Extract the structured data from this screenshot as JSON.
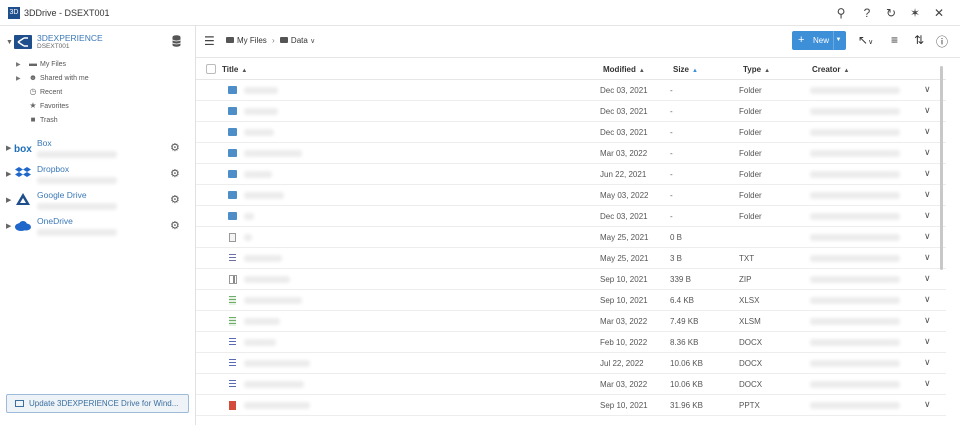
{
  "window": {
    "title": "3DDrive - DSEXT001",
    "logo_letter": "3D"
  },
  "sidebar": {
    "drives": [
      {
        "name": "3DEXPERIENCE",
        "subtitle": "DSEXT001",
        "logo": "3dexperience-logo"
      },
      {
        "name": "Box",
        "logo": "box-logo"
      },
      {
        "name": "Dropbox",
        "logo": "dropbox-logo"
      },
      {
        "name": "Google Drive",
        "logo": "google-drive-logo"
      },
      {
        "name": "OneDrive",
        "logo": "onedrive-logo"
      }
    ],
    "items": [
      {
        "label": "My Files",
        "icon": "folder-icon"
      },
      {
        "label": "Shared with me",
        "icon": "users-icon"
      },
      {
        "label": "Recent",
        "icon": "clock-icon"
      },
      {
        "label": "Favorites",
        "icon": "star-icon"
      },
      {
        "label": "Trash",
        "icon": "trash-icon"
      }
    ],
    "update_button": "Update 3DEXPERIENCE Drive for Wind..."
  },
  "toolbar": {
    "breadcrumb": [
      "My Files",
      "Data"
    ],
    "new_label": "New"
  },
  "table": {
    "columns": {
      "title": "Title",
      "modified": "Modified",
      "size": "Size",
      "type": "Type",
      "creator": "Creator"
    },
    "rows": [
      {
        "modified": "Dec 03, 2021",
        "size": "-",
        "type": "Folder",
        "icon": "folder"
      },
      {
        "modified": "Dec 03, 2021",
        "size": "-",
        "type": "Folder",
        "icon": "folder"
      },
      {
        "modified": "Dec 03, 2021",
        "size": "-",
        "type": "Folder",
        "icon": "folder"
      },
      {
        "modified": "Mar 03, 2022",
        "size": "-",
        "type": "Folder",
        "icon": "folder"
      },
      {
        "modified": "Jun 22, 2021",
        "size": "-",
        "type": "Folder",
        "icon": "folder"
      },
      {
        "modified": "May 03, 2022",
        "size": "-",
        "type": "Folder",
        "icon": "folder"
      },
      {
        "modified": "Dec 03, 2021",
        "size": "-",
        "type": "Folder",
        "icon": "folder"
      },
      {
        "modified": "May 25, 2021",
        "size": "0 B",
        "type": "",
        "icon": "doc"
      },
      {
        "modified": "May 25, 2021",
        "size": "3 B",
        "type": "TXT",
        "icon": "txt"
      },
      {
        "modified": "Sep 10, 2021",
        "size": "339 B",
        "type": "ZIP",
        "icon": "zip"
      },
      {
        "modified": "Sep 10, 2021",
        "size": "6.4 KB",
        "type": "XLSX",
        "icon": "xls"
      },
      {
        "modified": "Mar 03, 2022",
        "size": "7.49 KB",
        "type": "XLSM",
        "icon": "xls"
      },
      {
        "modified": "Feb 10, 2022",
        "size": "8.36 KB",
        "type": "DOCX",
        "icon": "docx"
      },
      {
        "modified": "Jul 22, 2022",
        "size": "10.06 KB",
        "type": "DOCX",
        "icon": "docx"
      },
      {
        "modified": "Mar 03, 2022",
        "size": "10.06 KB",
        "type": "DOCX",
        "icon": "docx"
      },
      {
        "modified": "Sep 10, 2021",
        "size": "31.96 KB",
        "type": "PPTX",
        "icon": "ppt"
      }
    ]
  }
}
